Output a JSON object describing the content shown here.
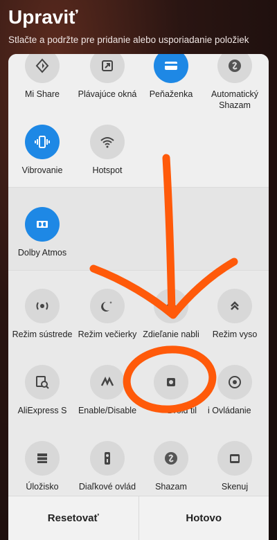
{
  "header": {
    "title": "Upraviť",
    "subtitle": "Stlačte a podržte pre pridanie alebo usporiadanie položiek"
  },
  "tiles_active": [
    {
      "label": "Mi Share",
      "icon": "mi-share-icon",
      "active": false
    },
    {
      "label": "Plávajúce okná",
      "icon": "floating-window-icon",
      "active": false
    },
    {
      "label": "Peňaženka",
      "icon": "wallet-icon",
      "active": true
    },
    {
      "label": "Automatický Shazam",
      "icon": "shazam-icon",
      "active": false
    },
    {
      "label": "Vibrovanie",
      "icon": "vibrate-icon",
      "active": true
    },
    {
      "label": "Hotspot",
      "icon": "hotspot-icon",
      "active": false
    }
  ],
  "tiles_middle": [
    {
      "label": "Dolby Atmos",
      "icon": "dolby-icon",
      "active": true
    }
  ],
  "tiles_available": [
    {
      "label": "Režim sústrede",
      "icon": "focus-icon"
    },
    {
      "label": "Režim večierky",
      "icon": "bedtime-icon"
    },
    {
      "label": "Zdieľanie nabli",
      "icon": "nearby-share-icon"
    },
    {
      "label": "Režim vyso",
      "icon": "high-mode-icon"
    },
    {
      "label": "AliExpress S",
      "icon": "aliexpress-icon"
    },
    {
      "label": "Enable/Disable",
      "icon": "toggle-m-icon"
    },
    {
      "label": "Droid til",
      "icon": "gear-icon"
    },
    {
      "label": "i Ovládanie",
      "icon": "control-icon"
    },
    {
      "label": "Úložisko",
      "icon": "storage-icon"
    },
    {
      "label": "Diaľkové ovlád",
      "icon": "remote-icon"
    },
    {
      "label": "Shazam",
      "icon": "shazam-icon"
    },
    {
      "label": "Skenuj",
      "icon": "scan-icon"
    }
  ],
  "buttons": {
    "reset": "Resetovať",
    "done": "Hotovo"
  },
  "colors": {
    "accent": "#1e88e5",
    "annotation": "#ff5a0a"
  }
}
